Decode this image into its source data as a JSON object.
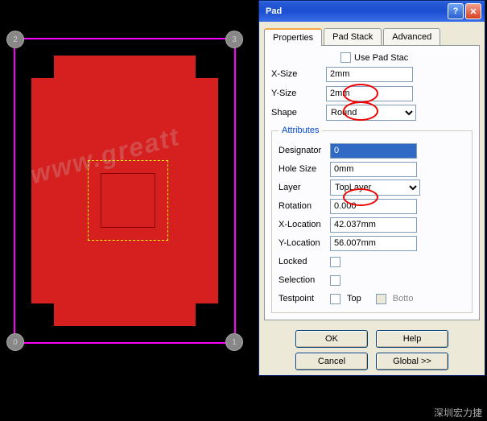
{
  "dialog": {
    "title": "Pad",
    "tabs": {
      "properties": "Properties",
      "padstack": "Pad Stack",
      "advanced": "Advanced"
    },
    "use_pad_stack": "Use Pad Stac",
    "labels": {
      "xsize": "X-Size",
      "ysize": "Y-Size",
      "shape": "Shape",
      "attributes": "Attributes",
      "designator": "Designator",
      "holesize": "Hole Size",
      "layer": "Layer",
      "rotation": "Rotation",
      "xloc": "X-Location",
      "yloc": "Y-Location",
      "locked": "Locked",
      "selection": "Selection",
      "testpoint": "Testpoint",
      "top": "Top",
      "bottom": "Botto"
    },
    "values": {
      "xsize": "2mm",
      "ysize": "2mm",
      "shape": "Round",
      "designator": "0",
      "holesize": "0mm",
      "layer": "TopLayer",
      "rotation": "0.000",
      "xloc": "42.037mm",
      "yloc": "56.007mm"
    },
    "buttons": {
      "ok": "OK",
      "help": "Help",
      "cancel": "Cancel",
      "global": "Global >>"
    }
  },
  "pcb": {
    "vias": [
      "0",
      "1",
      "2",
      "3"
    ],
    "watermark": "www.greatt"
  },
  "corner": "深圳宏力捷"
}
